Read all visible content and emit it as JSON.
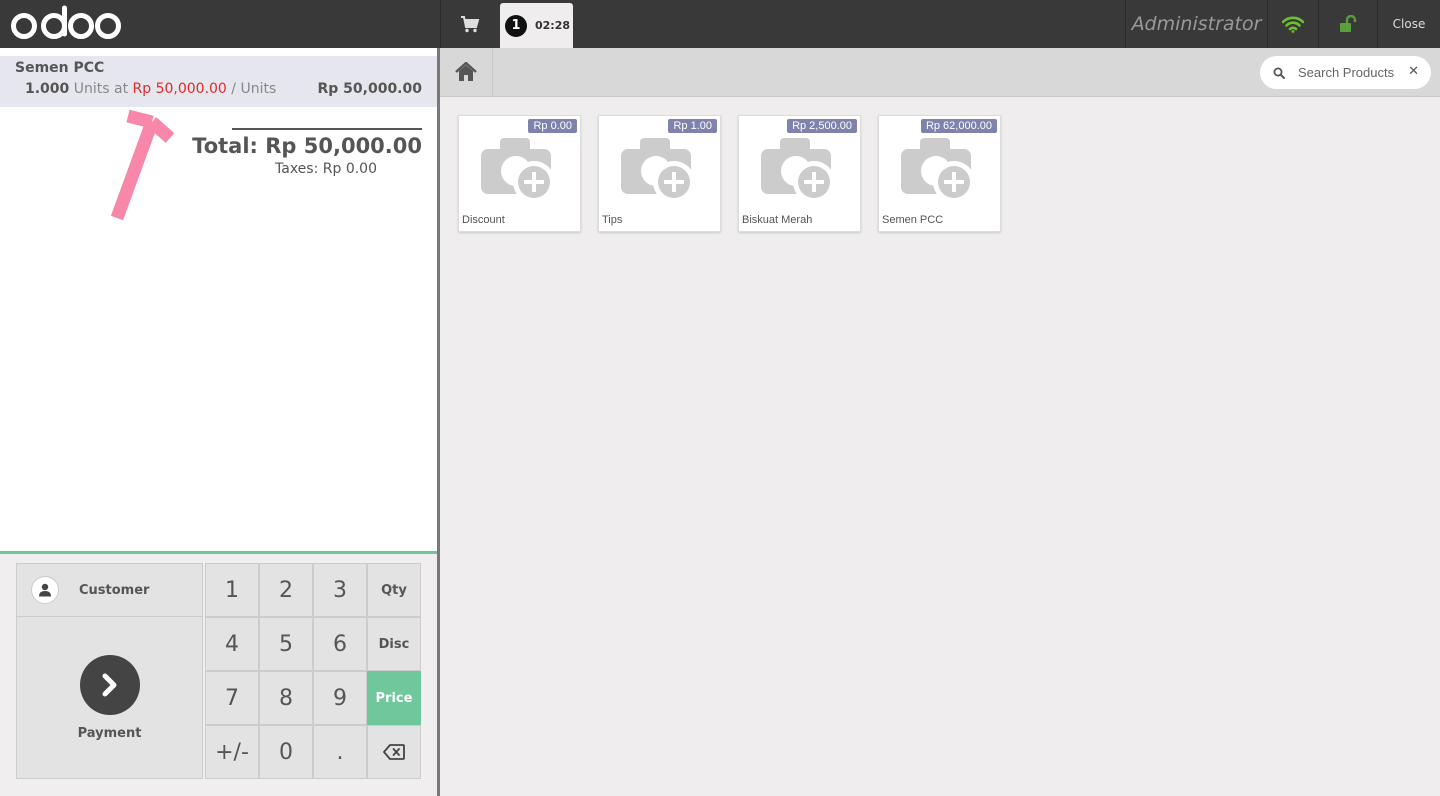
{
  "header": {
    "logo_text": "odoo",
    "order_number": "1",
    "order_time": "02:28",
    "user": "Administrator",
    "close_label": "Close",
    "colors": {
      "bar": "#393939",
      "wifi": "#6ec12e",
      "lock": "#5aa03a"
    },
    "icons": {
      "cart": "cart-icon",
      "wifi": "wifi-icon",
      "lock": "unlock-icon"
    }
  },
  "order": {
    "lines": [
      {
        "product": "Semen PCC",
        "quantity": "1.000",
        "units_at": "Units at",
        "unit_price": "Rp 50,000.00",
        "unit_suffix": "/ Units",
        "line_total": "Rp 50,000.00"
      }
    ],
    "total": "Total: Rp 50,000.00",
    "taxes": "Taxes: Rp 0.00",
    "colors": {
      "highlight_price": "#e02b27"
    }
  },
  "controls": {
    "customer_label": "Customer",
    "payment_label": "Payment",
    "keys": [
      "1",
      "2",
      "3",
      "Qty",
      "4",
      "5",
      "6",
      "Disc",
      "7",
      "8",
      "9",
      "Price",
      "+/-",
      "0",
      ".",
      "backspace-icon"
    ],
    "active_mode": "Price",
    "colors": {
      "accent": "#6ec89b"
    }
  },
  "products_pane": {
    "search_placeholder": "Search Products",
    "products": [
      {
        "name": "Discount",
        "price": "Rp 0.00"
      },
      {
        "name": "Tips",
        "price": "Rp 1.00"
      },
      {
        "name": "Biskuat Merah",
        "price": "Rp 2,500.00"
      },
      {
        "name": "Semen PCC",
        "price": "Rp 62,000.00"
      }
    ],
    "colors": {
      "price_tag": "#7f82ac"
    }
  }
}
